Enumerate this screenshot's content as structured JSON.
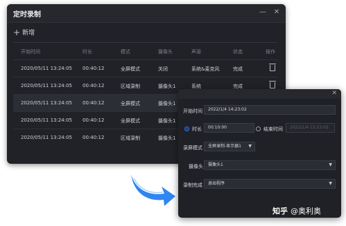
{
  "main_window": {
    "title": "定时录制",
    "minimize_glyph": "—",
    "close_glyph": "✕",
    "add_label": "新增",
    "columns": [
      "开始时间",
      "时长",
      "模式",
      "摄像头",
      "声源",
      "状态",
      "操作"
    ],
    "rows": [
      {
        "start": "2020/05/11  13:24:05",
        "duration": "00:40:12",
        "mode": "全屏模式",
        "camera": "关闭",
        "audio": "系统&麦克风",
        "status": "完成"
      },
      {
        "start": "2020/05/11  13:24:05",
        "duration": "00:40:12",
        "mode": "区域录制",
        "camera": "摄像头1",
        "audio": "系统",
        "status": "完成"
      },
      {
        "start": "2020/05/11  13:24:05",
        "duration": "00:40:12",
        "mode": "全屏模式",
        "camera": "摄像头1",
        "audio": "",
        "status": ""
      },
      {
        "start": "2020/05/11  13:24:05",
        "duration": "00:40:12",
        "mode": "全屏模式",
        "camera": "摄像头1",
        "audio": "",
        "status": ""
      },
      {
        "start": "2020/05/11  13:24:05",
        "duration": "00:40:12",
        "mode": "区域录制",
        "camera": "摄像头1",
        "audio": "",
        "status": ""
      }
    ],
    "selected_row": 2,
    "row_action_icon": "trash-icon"
  },
  "dialog": {
    "close_glyph": "✕",
    "start_time_label": "开始时间",
    "start_time_value": "2022/1/4  14:23:02",
    "duration_label": "时长",
    "duration_value": "00:10:00",
    "end_time_label": "结束时间",
    "end_time_value": "2022/1/4  13:23:02",
    "record_mode_label": "录屏模式",
    "record_mode_value": "全屏录制-显示器1",
    "camera_label": "摄像头",
    "camera_value": "摄像头1",
    "on_complete_label": "录制完成",
    "on_complete_value": "退出程序",
    "selected_option": "duration"
  },
  "watermark": {
    "logo": "知乎",
    "handle": "@奥利奥"
  },
  "colors": {
    "window_bg": "#202227",
    "accent": "#2f7bf6",
    "arrow": "#2f86f0"
  }
}
